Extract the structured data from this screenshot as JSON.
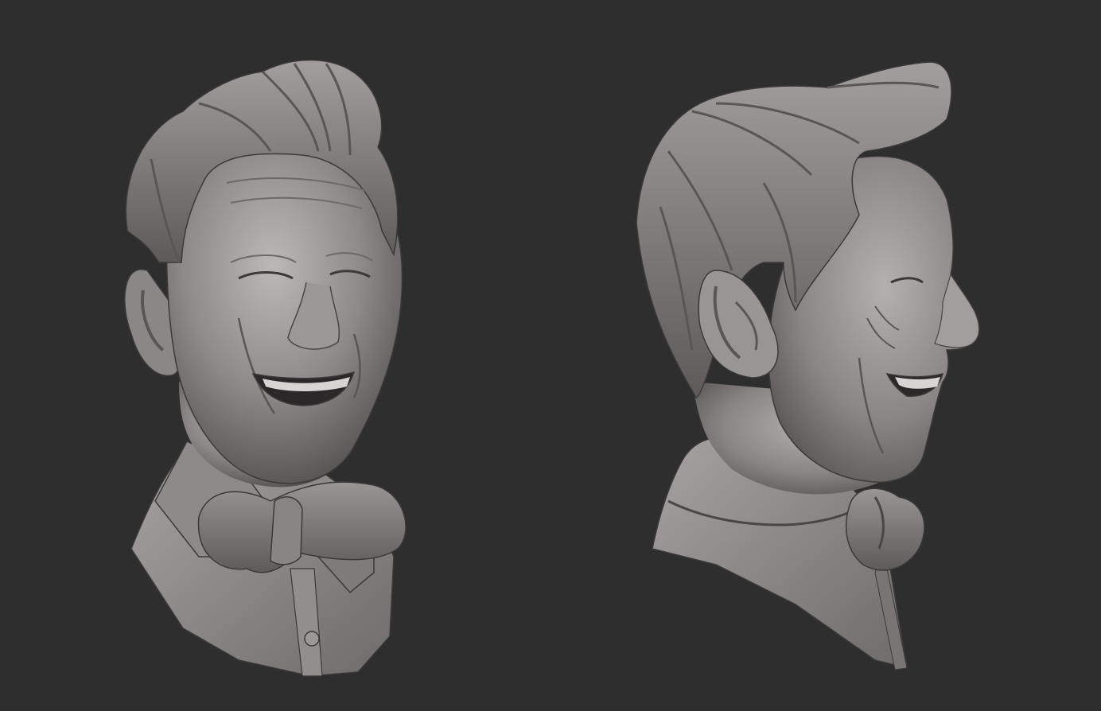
{
  "scene": {
    "background_color": "#2e2e2e",
    "material_color": "#8a8585",
    "views": [
      {
        "id": "front-three-quarter",
        "label": ""
      },
      {
        "id": "side-profile",
        "label": ""
      }
    ]
  }
}
